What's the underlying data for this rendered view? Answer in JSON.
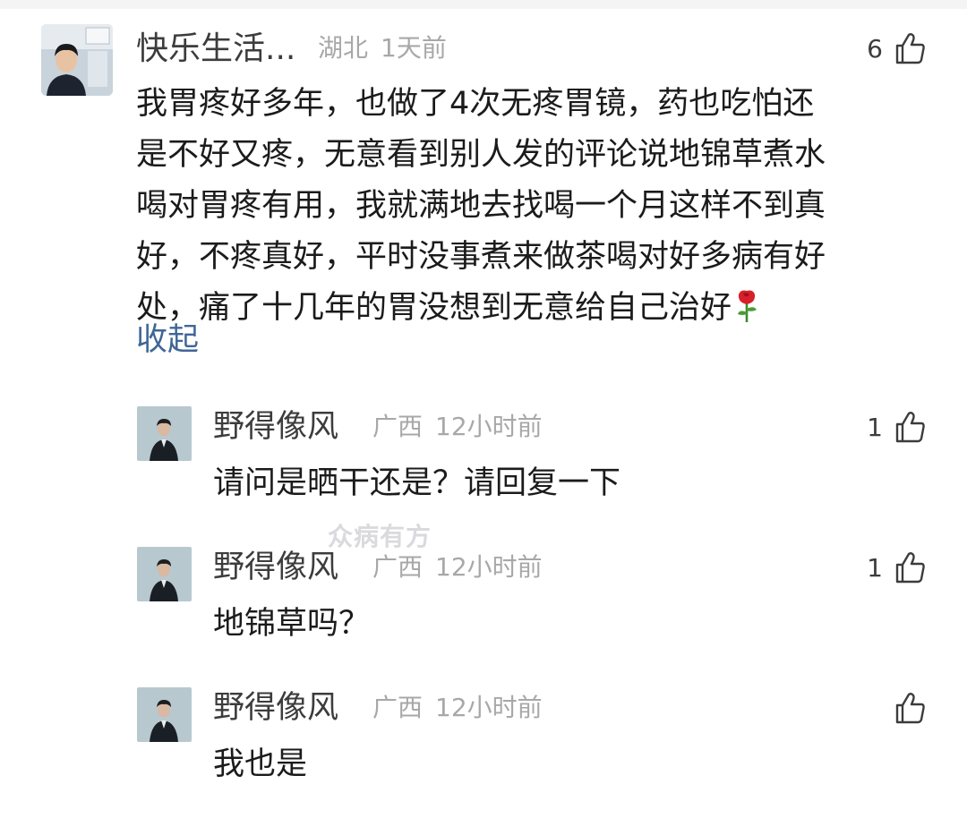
{
  "main_comment": {
    "author": "快乐生活...",
    "location": "湖北",
    "time": "1天前",
    "likes": "6",
    "text": "我胃疼好多年，也做了4次无疼胃镜，药也吃怕还\n是不好又疼，无意看到别人发的评论说地锦草煮水\n喝对胃疼有用，我就满地去找喝一个月这样不到真\n好，不疼真好，平时没事煮来做茶喝对好多病有好\n处，痛了十几年的胃没想到无意给自己治好",
    "emoji": "rose-icon",
    "collapse_label": "收起"
  },
  "replies": [
    {
      "author": "野得像风",
      "location": "广西",
      "time": "12小时前",
      "likes": "1",
      "text": "请问是晒干还是？请回复一下"
    },
    {
      "author": "野得像风",
      "location": "广西",
      "time": "12小时前",
      "likes": "1",
      "text": "地锦草吗？"
    },
    {
      "author": "野得像风",
      "location": "广西",
      "time": "12小时前",
      "likes": "",
      "text": "我也是"
    }
  ],
  "watermark": "众病有方",
  "icons": {
    "like": "thumbs-up-icon",
    "avatar_main": "user-avatar",
    "avatar_reply": "user-avatar"
  },
  "colors": {
    "name": "#3c3c3c",
    "meta": "#a8a8a8",
    "body": "#1b1b1b",
    "link": "#3f6697"
  }
}
